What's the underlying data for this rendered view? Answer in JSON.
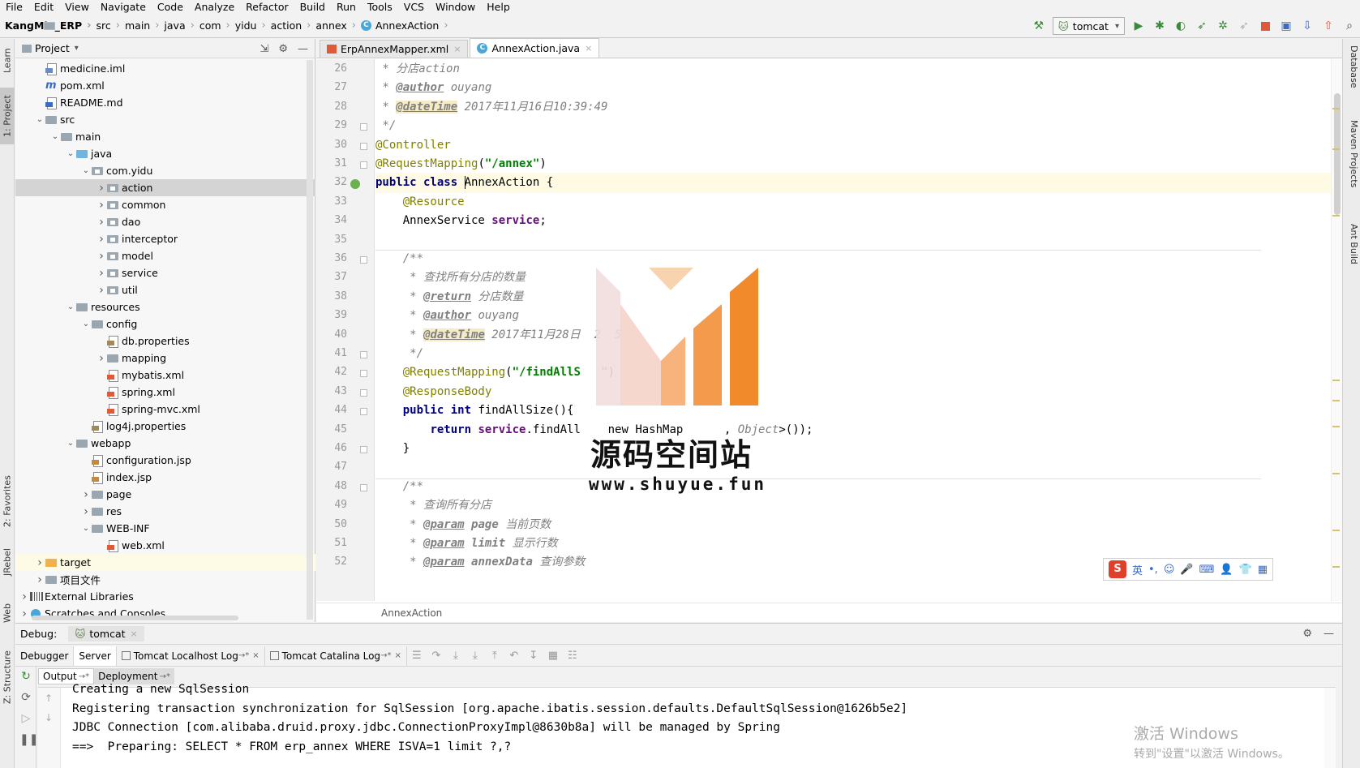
{
  "menu": [
    "File",
    "Edit",
    "View",
    "Navigate",
    "Code",
    "Analyze",
    "Refactor",
    "Build",
    "Run",
    "Tools",
    "VCS",
    "Window",
    "Help"
  ],
  "breadcrumb": {
    "project": "KangMin_ERP",
    "parts": [
      "src",
      "main",
      "java",
      "com",
      "yidu",
      "action",
      "annex"
    ],
    "class_name": "AnnexAction"
  },
  "run_config": "tomcat",
  "left_strip": {
    "learn": "Learn",
    "project": "1: Project",
    "favorites": "2: Favorites",
    "jrebel": "JRebel",
    "web": "Web",
    "structure": "Z: Structure"
  },
  "right_strip": {
    "database": "Database",
    "maven": "Maven Projects",
    "ant": "Ant Build"
  },
  "project_panel": {
    "title": "Project",
    "tree": [
      {
        "label": "medicine.iml",
        "depth": 1,
        "icon": "iml",
        "arrow": ""
      },
      {
        "label": "pom.xml",
        "depth": 1,
        "icon": "pom",
        "arrow": ""
      },
      {
        "label": "README.md",
        "depth": 1,
        "icon": "md",
        "arrow": ""
      },
      {
        "label": "src",
        "depth": 1,
        "icon": "folder",
        "arrow": "down"
      },
      {
        "label": "main",
        "depth": 2,
        "icon": "folder",
        "arrow": "down"
      },
      {
        "label": "java",
        "depth": 3,
        "icon": "srcfolder",
        "arrow": "down"
      },
      {
        "label": "com.yidu",
        "depth": 4,
        "icon": "pkg",
        "arrow": "down"
      },
      {
        "label": "action",
        "depth": 5,
        "icon": "pkg",
        "arrow": "right",
        "selected": true
      },
      {
        "label": "common",
        "depth": 5,
        "icon": "pkg",
        "arrow": "right"
      },
      {
        "label": "dao",
        "depth": 5,
        "icon": "pkg",
        "arrow": "right"
      },
      {
        "label": "interceptor",
        "depth": 5,
        "icon": "pkg",
        "arrow": "right"
      },
      {
        "label": "model",
        "depth": 5,
        "icon": "pkg",
        "arrow": "right"
      },
      {
        "label": "service",
        "depth": 5,
        "icon": "pkg",
        "arrow": "right"
      },
      {
        "label": "util",
        "depth": 5,
        "icon": "pkg",
        "arrow": "right"
      },
      {
        "label": "resources",
        "depth": 3,
        "icon": "folder",
        "arrow": "down"
      },
      {
        "label": "config",
        "depth": 4,
        "icon": "folder",
        "arrow": "down"
      },
      {
        "label": "db.properties",
        "depth": 5,
        "icon": "props",
        "arrow": ""
      },
      {
        "label": "mapping",
        "depth": 5,
        "icon": "folder",
        "arrow": "right"
      },
      {
        "label": "mybatis.xml",
        "depth": 5,
        "icon": "xml",
        "arrow": ""
      },
      {
        "label": "spring.xml",
        "depth": 5,
        "icon": "xml",
        "arrow": ""
      },
      {
        "label": "spring-mvc.xml",
        "depth": 5,
        "icon": "xml",
        "arrow": ""
      },
      {
        "label": "log4j.properties",
        "depth": 4,
        "icon": "props",
        "arrow": ""
      },
      {
        "label": "webapp",
        "depth": 3,
        "icon": "folder",
        "arrow": "down"
      },
      {
        "label": "configuration.jsp",
        "depth": 4,
        "icon": "jsp",
        "arrow": ""
      },
      {
        "label": "index.jsp",
        "depth": 4,
        "icon": "jsp",
        "arrow": ""
      },
      {
        "label": "page",
        "depth": 4,
        "icon": "folder",
        "arrow": "right"
      },
      {
        "label": "res",
        "depth": 4,
        "icon": "folder",
        "arrow": "right"
      },
      {
        "label": "WEB-INF",
        "depth": 4,
        "icon": "folder",
        "arrow": "down"
      },
      {
        "label": "web.xml",
        "depth": 5,
        "icon": "xml",
        "arrow": ""
      },
      {
        "label": "target",
        "depth": 1,
        "icon": "orange",
        "arrow": "right",
        "highlight": true
      },
      {
        "label": "项目文件",
        "depth": 1,
        "icon": "folder",
        "arrow": "right"
      },
      {
        "label": "External Libraries",
        "depth": 0,
        "icon": "lib",
        "arrow": "right"
      },
      {
        "label": "Scratches and Consoles",
        "depth": 0,
        "icon": "scratch",
        "arrow": "right"
      }
    ]
  },
  "editor": {
    "tabs": [
      {
        "label": "ErpAnnexMapper.xml",
        "active": false
      },
      {
        "label": "AnnexAction.java",
        "active": true
      }
    ],
    "line_numbers": [
      "26",
      "27",
      "28",
      "29",
      "30",
      "31",
      "32",
      "33",
      "34",
      "35",
      "36",
      "37",
      "38",
      "39",
      "40",
      "41",
      "42",
      "43",
      "44",
      "45",
      "46",
      "47",
      "48",
      "49",
      "50",
      "51",
      "52"
    ],
    "code_lines": [
      [
        {
          "t": " * 分店",
          "c": "com"
        },
        {
          "t": "action",
          "c": "com"
        }
      ],
      [
        {
          "t": " * ",
          "c": "com"
        },
        {
          "t": "@author",
          "c": "tag"
        },
        {
          "t": " ouyang",
          "c": "com"
        }
      ],
      [
        {
          "t": " * ",
          "c": "com"
        },
        {
          "t": "@dateTime",
          "c": "tagbg"
        },
        {
          "t": " 2017年11月16日10:39:49",
          "c": "com"
        }
      ],
      [
        {
          "t": " */",
          "c": "com"
        }
      ],
      [
        {
          "t": "@Controller",
          "c": "ann"
        }
      ],
      [
        {
          "t": "@RequestMapping",
          "c": "ann"
        },
        {
          "t": "(",
          "c": ""
        },
        {
          "t": "\"/annex\"",
          "c": "str"
        },
        {
          "t": ")",
          "c": ""
        }
      ],
      [
        {
          "t": "public class ",
          "c": "kw"
        },
        {
          "t": "AnnexAction {",
          "c": ""
        }
      ],
      [
        {
          "t": "    ",
          "c": ""
        },
        {
          "t": "@Resource",
          "c": "ann"
        }
      ],
      [
        {
          "t": "    AnnexService ",
          "c": ""
        },
        {
          "t": "service",
          "c": "fld"
        },
        {
          "t": ";",
          "c": ""
        }
      ],
      [],
      [
        {
          "t": "    /**",
          "c": "com"
        }
      ],
      [
        {
          "t": "     * 查找所有分店的数量",
          "c": "com"
        }
      ],
      [
        {
          "t": "     * ",
          "c": "com"
        },
        {
          "t": "@return",
          "c": "tag"
        },
        {
          "t": " 分店数量",
          "c": "com"
        }
      ],
      [
        {
          "t": "     * ",
          "c": "com"
        },
        {
          "t": "@author",
          "c": "tag"
        },
        {
          "t": " ouyang",
          "c": "com"
        }
      ],
      [
        {
          "t": "     * ",
          "c": "com"
        },
        {
          "t": "@dateTime",
          "c": "tagbg"
        },
        {
          "t": " 2017年11月28日  2  5",
          "c": "com"
        }
      ],
      [
        {
          "t": "     */",
          "c": "com"
        }
      ],
      [
        {
          "t": "    ",
          "c": ""
        },
        {
          "t": "@RequestMapping",
          "c": "ann"
        },
        {
          "t": "(",
          "c": ""
        },
        {
          "t": "\"/findAllS   \"",
          "c": "str"
        },
        {
          "t": ")",
          "c": ""
        }
      ],
      [
        {
          "t": "    ",
          "c": ""
        },
        {
          "t": "@ResponseBody",
          "c": "ann"
        }
      ],
      [
        {
          "t": "    ",
          "c": ""
        },
        {
          "t": "public int ",
          "c": "kw"
        },
        {
          "t": "findAllSize(){",
          "c": ""
        }
      ],
      [
        {
          "t": "        ",
          "c": ""
        },
        {
          "t": "return ",
          "c": "kw"
        },
        {
          "t": "service",
          "c": "fld"
        },
        {
          "t": ".findAll    new HashMap      , ",
          "c": ""
        },
        {
          "t": "Object",
          "c": "com"
        },
        {
          "t": ">());",
          "c": ""
        }
      ],
      [
        {
          "t": "    }",
          "c": ""
        }
      ],
      [],
      [
        {
          "t": "    /**",
          "c": "com"
        }
      ],
      [
        {
          "t": "     * 查询所有分店",
          "c": "com"
        }
      ],
      [
        {
          "t": "     * ",
          "c": "com"
        },
        {
          "t": "@param",
          "c": "tag"
        },
        {
          "t": " ",
          "c": "com"
        },
        {
          "t": "page",
          "c": "par"
        },
        {
          "t": " 当前页数",
          "c": "com"
        }
      ],
      [
        {
          "t": "     * ",
          "c": "com"
        },
        {
          "t": "@param",
          "c": "tag"
        },
        {
          "t": " ",
          "c": "com"
        },
        {
          "t": "limit",
          "c": "par"
        },
        {
          "t": " 显示行数",
          "c": "com"
        }
      ],
      [
        {
          "t": "     * ",
          "c": "com"
        },
        {
          "t": "@param",
          "c": "tag"
        },
        {
          "t": " ",
          "c": "com"
        },
        {
          "t": "annexData",
          "c": "par"
        },
        {
          "t": " 查询参数",
          "c": "com"
        }
      ]
    ],
    "current_line_index": 6,
    "breadcrumb_label": "AnnexAction"
  },
  "watermark": {
    "title": "源码空间站",
    "url": "www.shuyue.fun"
  },
  "ime": {
    "lang": "英"
  },
  "debug": {
    "label": "Debug:",
    "session": "tomcat",
    "tabs": [
      {
        "label": "Debugger",
        "active": false
      },
      {
        "label": "Server",
        "active": true
      },
      {
        "label": "Tomcat Localhost Log",
        "active": false
      },
      {
        "label": "Tomcat Catalina Log",
        "active": false
      }
    ],
    "subtabs": [
      {
        "label": "Output",
        "active": true
      },
      {
        "label": "Deployment",
        "active": false
      }
    ],
    "console_lines": [
      "Creating a new SqlSession",
      "Registering transaction synchronization for SqlSession [org.apache.ibatis.session.defaults.DefaultSqlSession@1626b5e2]",
      "JDBC Connection [com.alibaba.druid.proxy.jdbc.ConnectionProxyImpl@8630b8a] will be managed by Spring",
      "==>  Preparing: SELECT * FROM erp_annex WHERE ISVA=1 limit ?,?"
    ]
  },
  "windows_activation": {
    "line1": "激活 Windows",
    "line2": "转到\"设置\"以激活 Windows。"
  },
  "colors": {
    "selection": "#d4d4d4",
    "current_line": "#fffae3",
    "run_green": "#3a8a3a",
    "stop_red": "#e05a3a"
  }
}
